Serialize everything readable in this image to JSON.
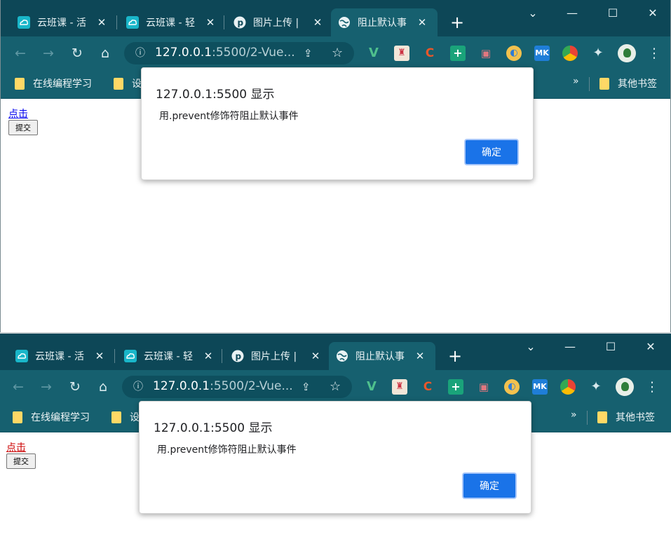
{
  "tabs": [
    {
      "title": "云班课 - 活",
      "favicon": "cloud-icon"
    },
    {
      "title": "云班课 - 轻",
      "favicon": "cloud-icon"
    },
    {
      "title": "图片上传 |",
      "favicon": "p-logo-icon"
    },
    {
      "title": "阻止默认事",
      "favicon": "globe-icon"
    }
  ],
  "window_controls": {
    "minimize": "—",
    "maximize": "☐",
    "close": "✕",
    "tab_search": "⌄"
  },
  "new_tab": "+",
  "address_bar": {
    "host": "127.0.0.1",
    "rest": ":5500/2-Vue..."
  },
  "bookmarks": {
    "first": "在线编程学习",
    "second": "设",
    "overflow": "»",
    "other": "其他书签"
  },
  "page": {
    "link_text": "点击",
    "submit_label": "提交"
  },
  "dialog": {
    "title": "127.0.0.1:5500 显示",
    "message": "用.prevent修饰符阻止默认事件",
    "ok_label": "确定"
  },
  "colors": {
    "tabbar": "#0d4757",
    "toolbar": "#16606f",
    "accent": "#1a73e8",
    "link_unvisited": "#0000ee",
    "link_active": "#cc0000"
  },
  "extensions": [
    "vue-devtools-icon",
    "fe-helper-icon",
    "c-plugin-icon",
    "plus-square-icon",
    "tv-icon",
    "bird-icon",
    "mk-icon",
    "chrome-ring-icon",
    "puzzle-icon"
  ]
}
